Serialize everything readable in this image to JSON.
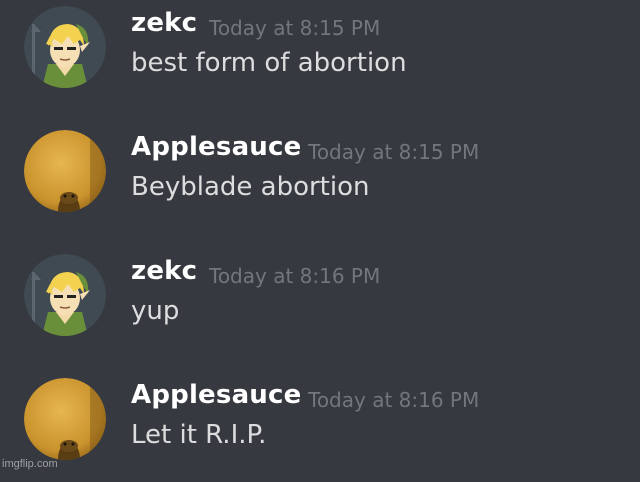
{
  "messages": [
    {
      "author": "zekc",
      "timestamp": "Today at 8:15 PM",
      "content": "best form of abortion",
      "avatar": "zekc-avatar"
    },
    {
      "author": "Applesauce",
      "timestamp": "Today at 8:15 PM",
      "content": "Beyblade abortion",
      "avatar": "applesauce-avatar"
    },
    {
      "author": "zekc",
      "timestamp": "Today at 8:16 PM",
      "content": "yup",
      "avatar": "zekc-avatar"
    },
    {
      "author": "Applesauce",
      "timestamp": "Today at 8:16 PM",
      "content": "Let it R.I.P.",
      "avatar": "applesauce-avatar"
    }
  ],
  "watermark": "imgflip.com",
  "colors": {
    "background": "#36393f",
    "author": "#ffffff",
    "timestamp": "#72767d",
    "content": "#dcddde"
  }
}
